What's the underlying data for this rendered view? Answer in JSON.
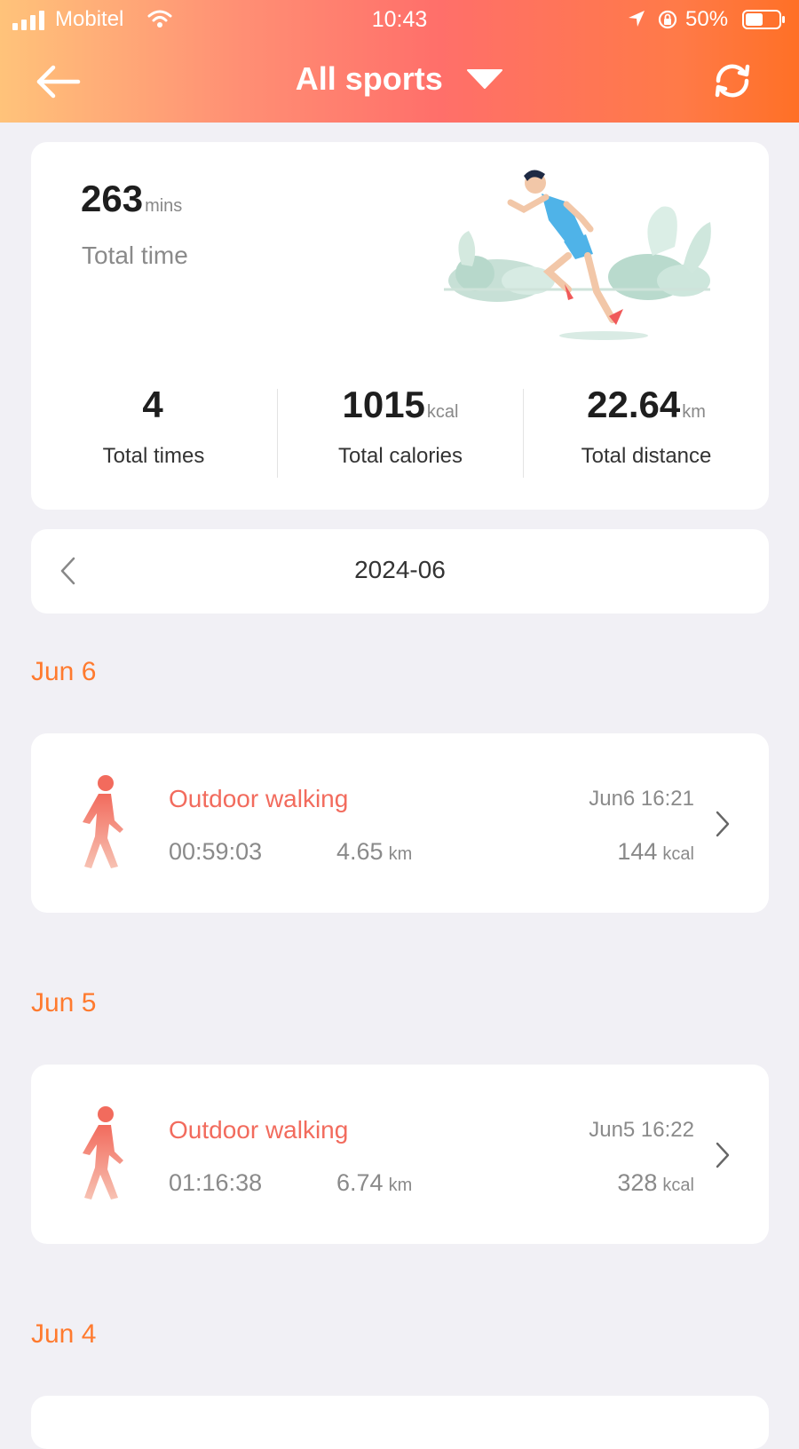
{
  "status_bar": {
    "carrier": "Mobitel",
    "time": "10:43",
    "battery": "50%"
  },
  "header": {
    "title": "All sports"
  },
  "summary": {
    "total_time_value": "263",
    "total_time_unit": "mins",
    "total_time_label": "Total time",
    "stats": [
      {
        "value": "4",
        "unit": "",
        "label": "Total times"
      },
      {
        "value": "1015",
        "unit": "kcal",
        "label": "Total calories"
      },
      {
        "value": "22.64",
        "unit": "km",
        "label": "Total distance"
      }
    ]
  },
  "month_nav": {
    "month": "2024-06"
  },
  "days": [
    {
      "label": "Jun 6",
      "activity": {
        "name": "Outdoor walking",
        "datetime": "Jun6 16:21",
        "duration": "00:59:03",
        "distance": "4.65",
        "distance_unit": "km",
        "calories": "144",
        "calories_unit": "kcal"
      }
    },
    {
      "label": "Jun 5",
      "activity": {
        "name": "Outdoor walking",
        "datetime": "Jun5 16:22",
        "duration": "01:16:38",
        "distance": "6.74",
        "distance_unit": "km",
        "calories": "328",
        "calories_unit": "kcal"
      }
    },
    {
      "label": "Jun 4"
    }
  ],
  "colors": {
    "accent_orange": "#ff7a2e",
    "activity_red": "#f26b5d",
    "background": "#f1f0f5"
  },
  "icons": {
    "back": "arrow-left-icon",
    "title_dropdown": "caret-down-icon",
    "sync": "sync-icon",
    "month_prev": "chevron-left-icon",
    "activity": "walking-person-icon",
    "activity_open": "chevron-right-icon"
  }
}
